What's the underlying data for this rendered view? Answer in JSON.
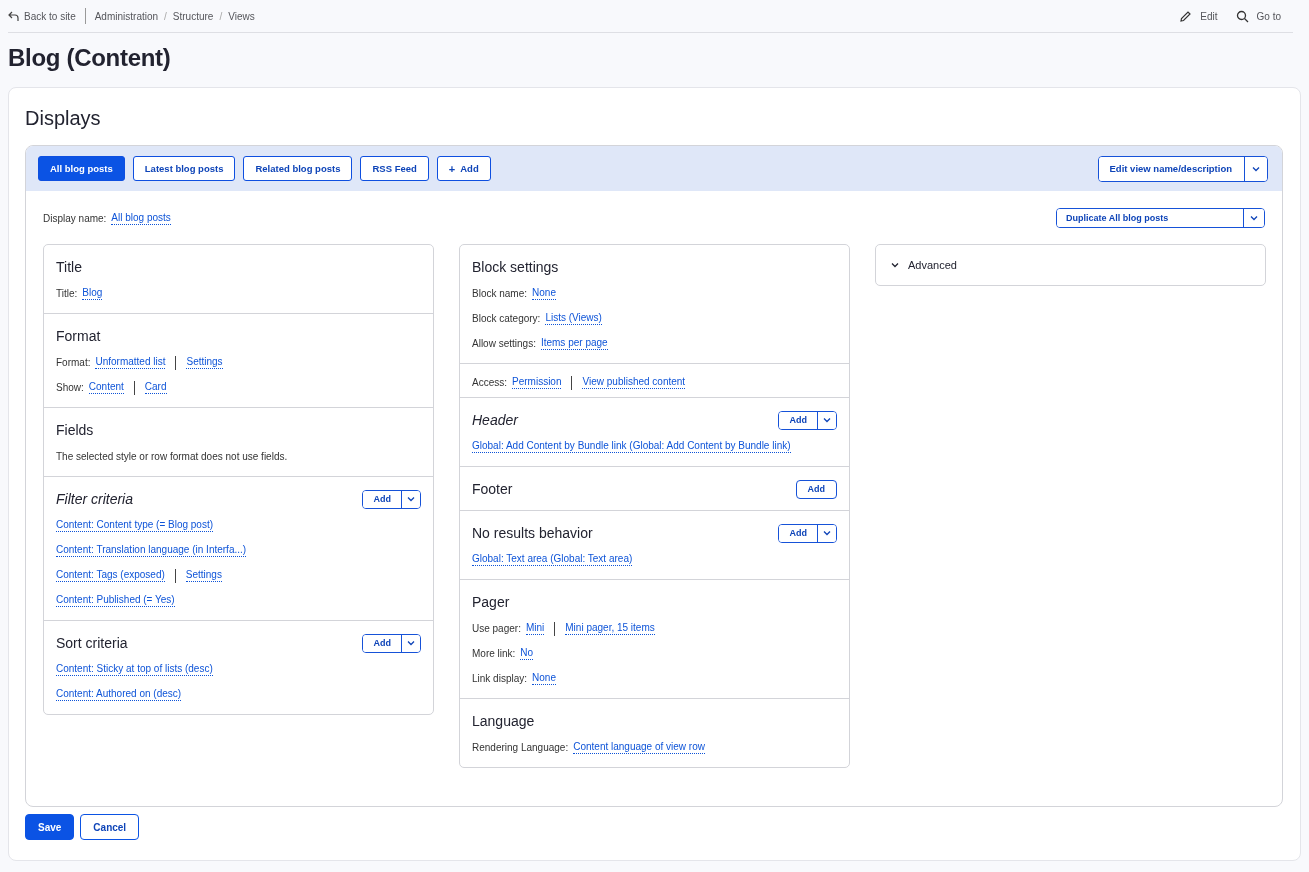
{
  "toolbar": {
    "back": "Back to site",
    "breadcrumbs": [
      "Administration",
      "Structure",
      "Views"
    ],
    "separators": [
      "/",
      "/"
    ],
    "actions": [
      {
        "kind": "edit",
        "label": "Edit"
      },
      {
        "kind": "search",
        "label": "Go to"
      }
    ]
  },
  "page_title": "Blog (Content)",
  "displays": {
    "heading": "Displays",
    "tabs": [
      {
        "label": "All blog posts",
        "selected": true,
        "kind": "tab"
      },
      {
        "label": "Latest blog posts",
        "selected": false,
        "kind": "tab"
      },
      {
        "label": "Related blog posts",
        "selected": false,
        "kind": "tab"
      },
      {
        "label": "RSS Feed",
        "selected": false,
        "kind": "tab"
      },
      {
        "label": "Add",
        "icon": "+",
        "selected": false,
        "kind": "add"
      }
    ],
    "edit_button": "Edit view name/description",
    "display_name": {
      "label": "Display name:",
      "value": "All blog posts"
    },
    "duplicate_button": "Duplicate All blog posts",
    "columns": [
      {
        "sections": [
          {
            "title": "Title",
            "overridden": false,
            "rows": [
              {
                "label": "Title:",
                "links": [
                  "Blog"
                ]
              }
            ]
          },
          {
            "title": "Format",
            "overridden": false,
            "rows": [
              {
                "label": "Format:",
                "links": [
                  "Unformatted list",
                  "Settings"
                ]
              },
              {
                "label": "Show:",
                "links": [
                  "Content",
                  "Card"
                ]
              }
            ]
          },
          {
            "title": "Fields",
            "overridden": false,
            "rows": [
              {
                "text": "The selected style or row format does not use fields."
              }
            ]
          },
          {
            "title": "Filter criteria",
            "overridden": true,
            "add": {
              "label": "Add",
              "dropdown": true
            },
            "rows": [
              {
                "links": [
                  "Content: Content type (= Blog post)"
                ]
              },
              {
                "links": [
                  "Content: Translation language (in Interfa...)"
                ]
              },
              {
                "links": [
                  "Content: Tags (exposed)",
                  "Settings"
                ]
              },
              {
                "links": [
                  "Content: Published (= Yes)"
                ]
              }
            ]
          },
          {
            "title": "Sort criteria",
            "overridden": false,
            "add": {
              "label": "Add",
              "dropdown": true
            },
            "rows": [
              {
                "links": [
                  "Content: Sticky at top of lists (desc)"
                ]
              },
              {
                "links": [
                  "Content: Authored on (desc)"
                ]
              }
            ]
          }
        ]
      },
      {
        "sections": [
          {
            "title": "Block settings",
            "overridden": false,
            "rows": [
              {
                "label": "Block name:",
                "links": [
                  "None"
                ]
              },
              {
                "label": "Block category:",
                "links": [
                  "Lists (Views)"
                ]
              },
              {
                "label": "Allow settings:",
                "links": [
                  "Items per page"
                ]
              }
            ]
          },
          {
            "rows": [
              {
                "label": "Access:",
                "links": [
                  "Permission",
                  "View published content"
                ]
              }
            ]
          },
          {
            "title": "Header",
            "overridden": true,
            "add": {
              "label": "Add",
              "dropdown": true
            },
            "rows": [
              {
                "links": [
                  "Global: Add Content by Bundle link (Global: Add Content by Bundle link)"
                ]
              }
            ]
          },
          {
            "title": "Footer",
            "overridden": false,
            "add": {
              "label": "Add",
              "dropdown": false
            }
          },
          {
            "title": "No results behavior",
            "overridden": false,
            "add": {
              "label": "Add",
              "dropdown": true
            },
            "rows": [
              {
                "links": [
                  "Global: Text area (Global: Text area)"
                ]
              }
            ]
          },
          {
            "title": "Pager",
            "overridden": false,
            "rows": [
              {
                "label": "Use pager:",
                "links": [
                  "Mini",
                  "Mini pager, 15 items"
                ]
              },
              {
                "label": "More link:",
                "links": [
                  "No"
                ]
              },
              {
                "label": "Link display:",
                "links": [
                  "None"
                ]
              }
            ]
          },
          {
            "title": "Language",
            "overridden": false,
            "rows": [
              {
                "label": "Rendering Language:",
                "links": [
                  "Content language of view row"
                ]
              }
            ]
          }
        ]
      },
      {
        "collapsible": {
          "label": "Advanced",
          "expanded": false
        }
      }
    ]
  },
  "buttons": [
    {
      "kind": "primary",
      "label": "Save"
    },
    {
      "kind": "secondary",
      "label": "Cancel"
    }
  ]
}
